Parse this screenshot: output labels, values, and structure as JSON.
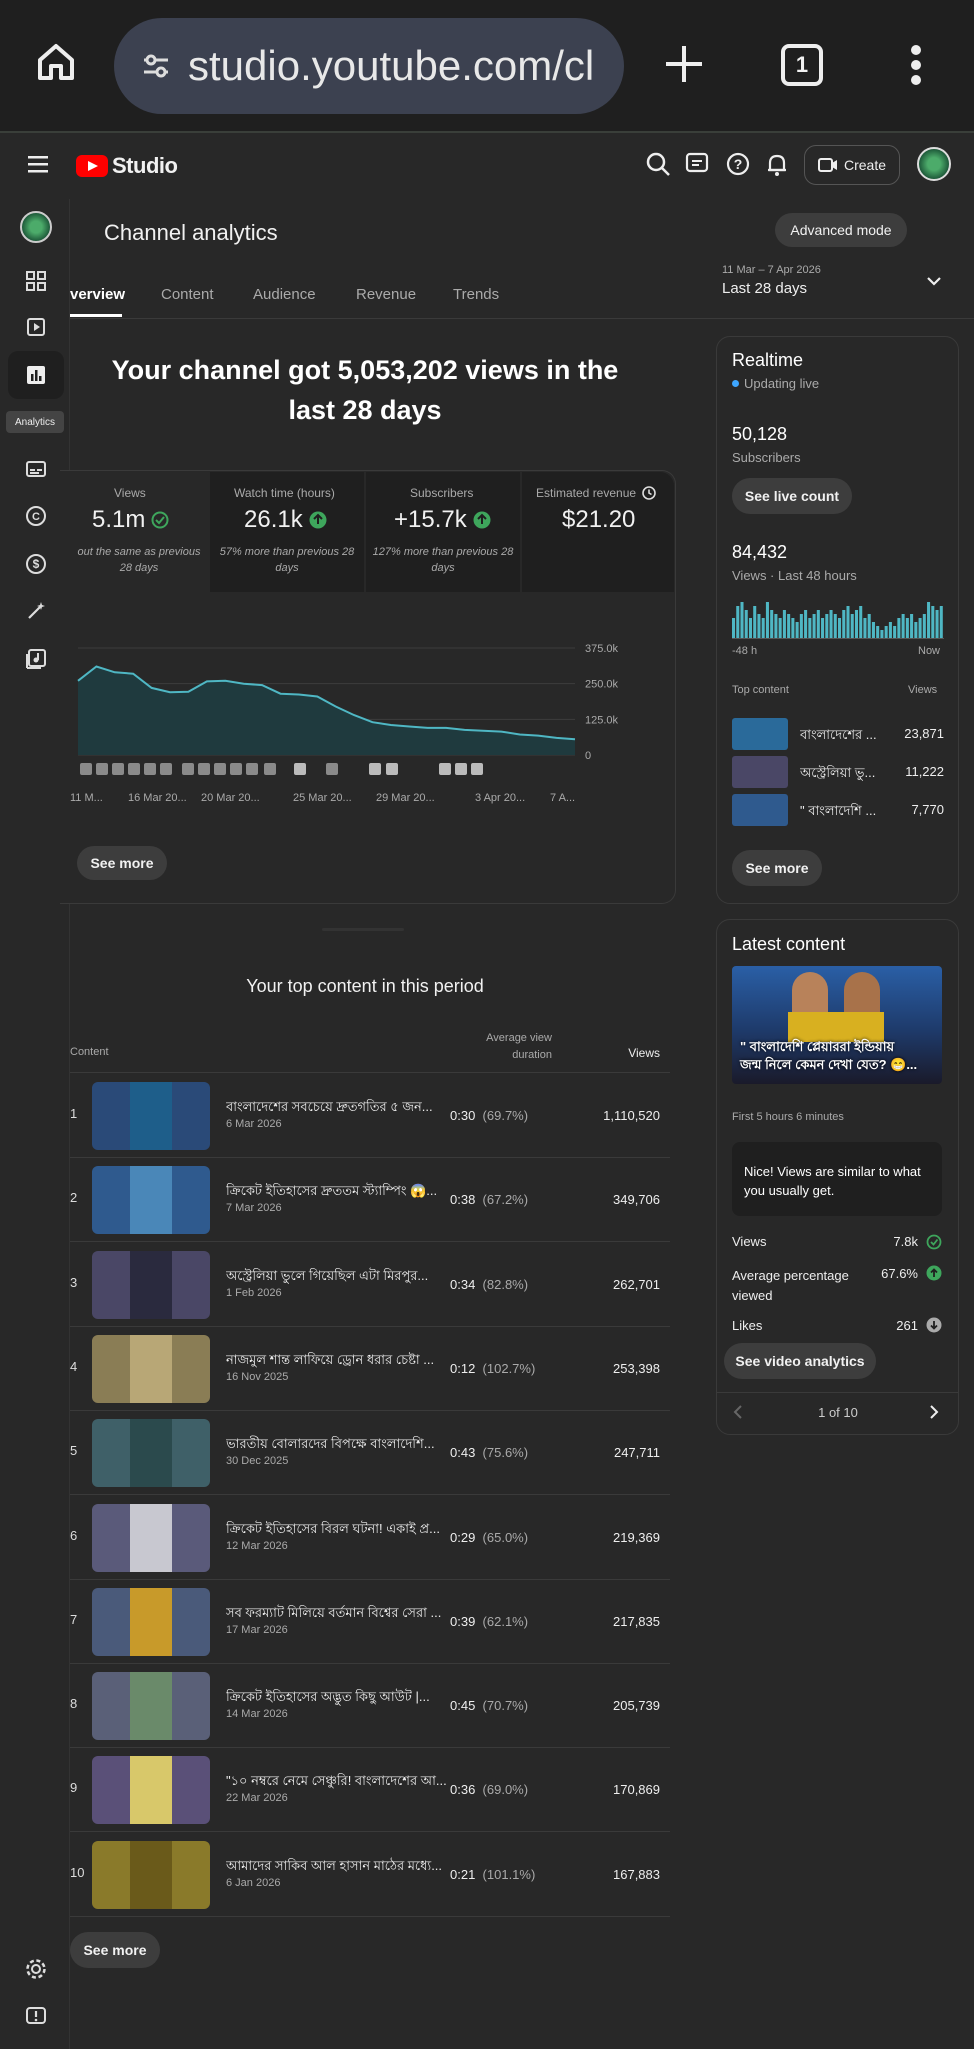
{
  "browser": {
    "url": "studio.youtube.com/cl",
    "tab_count": "1"
  },
  "header": {
    "logo_text": "Studio",
    "create_label": "Create"
  },
  "nav": {
    "active_tooltip": "Analytics"
  },
  "page": {
    "title": "Channel analytics",
    "advanced_mode": "Advanced mode",
    "date_range": "11 Mar – 7 Apr 2026",
    "date_label": "Last 28 days",
    "tabs": [
      "verview",
      "Content",
      "Audience",
      "Revenue",
      "Trends"
    ],
    "headline_line1": "Your channel got 5,053,202 views in the",
    "headline_line2": "last 28 days"
  },
  "metrics": [
    {
      "label": "Views",
      "value": "5.1m",
      "note1": "out the same as previous",
      "note2": "28 days",
      "status": "check"
    },
    {
      "label": "Watch time (hours)",
      "value": "26.1k",
      "note1": "57% more than previous 28",
      "note2": "days",
      "status": "up"
    },
    {
      "label": "Subscribers",
      "value": "+15.7k",
      "note1": "127% more than previous 28",
      "note2": "days",
      "status": "up"
    },
    {
      "label": "Estimated revenue",
      "value": "$21.20",
      "note1": "",
      "note2": "",
      "status": "clock"
    }
  ],
  "chart_data": {
    "type": "area",
    "y_tick_labels": [
      "375.0k",
      "250.0k",
      "125.0k",
      "0"
    ],
    "ylim": [
      0,
      375000
    ],
    "x_tick_labels": [
      "11 M...",
      "16 Mar 20...",
      "20 Mar 20...",
      "25 Mar 20...",
      "29 Mar 20...",
      "3 Apr 20...",
      "7 A..."
    ],
    "values": [
      260000,
      310000,
      290000,
      285000,
      235000,
      220000,
      222000,
      258000,
      260000,
      250000,
      245000,
      215000,
      212000,
      205000,
      170000,
      140000,
      115000,
      105000,
      100000,
      95000,
      95000,
      88000,
      85000,
      82000,
      72000,
      68000,
      60000,
      55000
    ],
    "grid": true
  },
  "overview_see_more": "See more",
  "top_content": {
    "title": "Your top content in this period",
    "col_content": "Content",
    "col_avd1": "Average view",
    "col_avd2": "duration",
    "col_views": "Views",
    "rows": [
      {
        "num": "1",
        "title": "বাংলাদেশের সবচেয়ে দ্রুতগতির ৫ জন...",
        "date": "6 Mar 2026",
        "dur": "0:30",
        "pct": "(69.7%)",
        "views": "1,110,520",
        "color": "#2a4a78",
        "inner": "#1e5e8a"
      },
      {
        "num": "2",
        "title": "ক্রিকেট ইতিহাসের দ্রুততম স্ট্যাম্পিং 😱...",
        "date": "7 Mar 2026",
        "dur": "0:38",
        "pct": "(67.2%)",
        "views": "349,706",
        "color": "#2f5a8e",
        "inner": "#4a87b8"
      },
      {
        "num": "3",
        "title": "অস্ট্রেলিয়া ভুলে গিয়েছিল এটা মিরপুর...",
        "date": "1 Feb 2026",
        "dur": "0:34",
        "pct": "(82.8%)",
        "views": "262,701",
        "color": "#4a4766",
        "inner": "#2a2a3e"
      },
      {
        "num": "4",
        "title": "নাজমুল শান্ত লাফিয়ে ড্রোন ধরার চেষ্টা ...",
        "date": "16 Nov 2025",
        "dur": "0:12",
        "pct": "(102.7%)",
        "views": "253,398",
        "color": "#8a7d55",
        "inner": "#b8a776"
      },
      {
        "num": "5",
        "title": "ভারতীয় বোলারদের বিপক্ষে বাংলাদেশি...",
        "date": "30 Dec 2025",
        "dur": "0:43",
        "pct": "(75.6%)",
        "views": "247,711",
        "color": "#3f6068",
        "inner": "#2b4a4d"
      },
      {
        "num": "6",
        "title": "ক্রিকেট ইতিহাসের বিরল ঘটনা! একাই প্র...",
        "date": "12 Mar 2026",
        "dur": "0:29",
        "pct": "(65.0%)",
        "views": "219,369",
        "color": "#5a5a7a",
        "inner": "#c8c8d0"
      },
      {
        "num": "7",
        "title": "সব ফরম্যাট মিলিয়ে বর্তমান বিশ্বের সেরা ...",
        "date": "17 Mar 2026",
        "dur": "0:39",
        "pct": "(62.1%)",
        "views": "217,835",
        "color": "#4a5a7a",
        "inner": "#c89a2a"
      },
      {
        "num": "8",
        "title": "ক্রিকেট ইতিহাসের অদ্ভুত কিছু আউট |...",
        "date": "14 Mar 2026",
        "dur": "0:45",
        "pct": "(70.7%)",
        "views": "205,739",
        "color": "#5a6078",
        "inner": "#6a8a6a"
      },
      {
        "num": "9",
        "title": "\"১০ নম্বরে নেমে সেঞ্চুরি! বাংলাদেশের আ...",
        "date": "22 Mar 2026",
        "dur": "0:36",
        "pct": "(69.0%)",
        "views": "170,869",
        "color": "#5a5078",
        "inner": "#d8c86a"
      },
      {
        "num": "10",
        "title": "আমাদের সাকিব আল হাসান মাঠের মধ্যে...",
        "date": "6 Jan 2026",
        "dur": "0:21",
        "pct": "(101.1%)",
        "views": "167,883",
        "color": "#8a7a2a",
        "inner": "#6a5a1a"
      }
    ],
    "see_more": "See more"
  },
  "realtime": {
    "title": "Realtime",
    "updating": "Updating live",
    "subs_value": "50,128",
    "subs_label": "Subscribers",
    "live_count": "See live count",
    "views_value": "84,432",
    "views_label": "Views · Last 48 hours",
    "axis_left": "-48 h",
    "axis_right": "Now",
    "bars": [
      0.5,
      0.8,
      0.9,
      0.7,
      0.5,
      0.8,
      0.6,
      0.5,
      0.9,
      0.7,
      0.6,
      0.5,
      0.7,
      0.6,
      0.5,
      0.4,
      0.6,
      0.7,
      0.5,
      0.6,
      0.7,
      0.5,
      0.6,
      0.7,
      0.6,
      0.5,
      0.7,
      0.8,
      0.6,
      0.7,
      0.8,
      0.5,
      0.6,
      0.4,
      0.3,
      0.2,
      0.3,
      0.4,
      0.3,
      0.5,
      0.6,
      0.5,
      0.6,
      0.4,
      0.5,
      0.6,
      0.9,
      0.8,
      0.7,
      0.8
    ],
    "top_content_label": "Top content",
    "views_col": "Views",
    "top": [
      {
        "title": "বাংলাদেশের ...",
        "views": "23,871",
        "color": "#2a6a9a"
      },
      {
        "title": "অস্ট্রেলিয়া ভু...",
        "views": "11,222",
        "color": "#4a4766"
      },
      {
        "title": "\" বাংলাদেশি ...",
        "views": "7,770",
        "color": "#2f5a8e"
      }
    ],
    "see_more": "See more"
  },
  "latest": {
    "title": "Latest content",
    "caption_line1": "\" বাংলাদেশি প্লেয়াররা ইন্ডিয়ায়",
    "caption_line2": "জন্ম নিলে কেমন দেখা যেত? 😁...",
    "first_label": "First 5 hours 6 minutes",
    "nice_line1": "Nice! Views are similar to what",
    "nice_line2": "you usually get.",
    "stats": [
      {
        "label": "Views",
        "value": "7.8k",
        "icon": "check"
      },
      {
        "label": "Average percentage viewed",
        "value": "67.6%",
        "icon": "up"
      },
      {
        "label": "Likes",
        "value": "261",
        "icon": "down"
      }
    ],
    "analytics_btn": "See video analytics",
    "pager": "1 of 10"
  }
}
